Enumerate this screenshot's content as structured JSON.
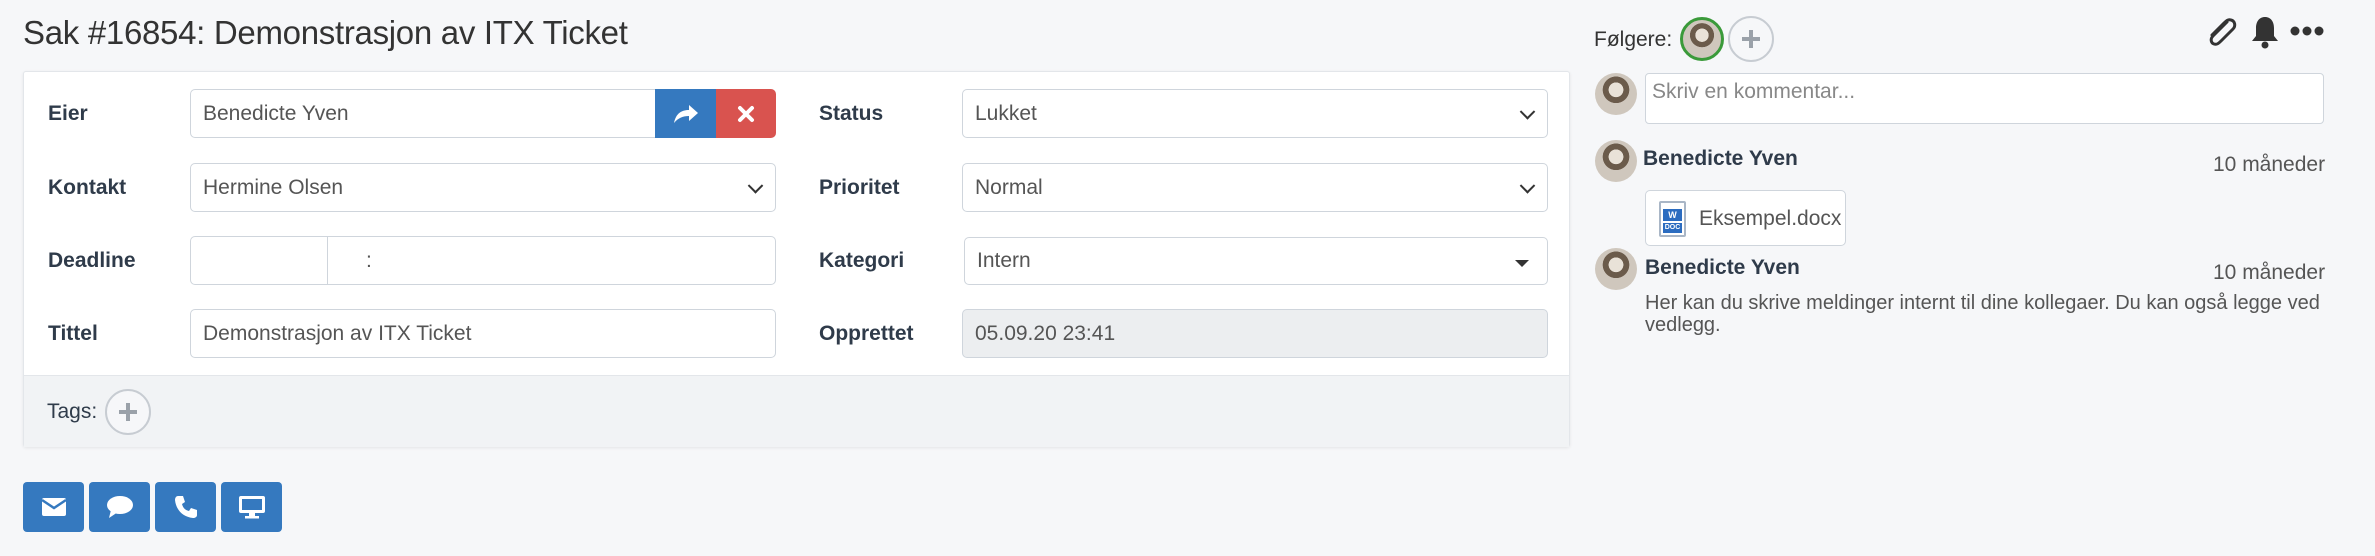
{
  "header": {
    "title": "Sak #16854: Demonstrasjon av ITX Ticket"
  },
  "form": {
    "owner": {
      "label": "Eier",
      "value": "Benedicte Yven"
    },
    "status": {
      "label": "Status",
      "value": "Lukket"
    },
    "contact": {
      "label": "Kontakt",
      "value": "Hermine Olsen"
    },
    "priority": {
      "label": "Prioritet",
      "value": "Normal"
    },
    "deadline": {
      "label": "Deadline",
      "date": "",
      "time_separator": ":"
    },
    "category": {
      "label": "Kategori",
      "value": "Intern"
    },
    "title_field": {
      "label": "Tittel",
      "value": "Demonstrasjon av ITX Ticket"
    },
    "created": {
      "label": "Opprettet",
      "value": "05.09.20 23:41"
    }
  },
  "tags": {
    "label": "Tags:"
  },
  "actions": [
    "envelope-icon",
    "speech-bubble-icon",
    "phone-icon",
    "monitor-icon"
  ],
  "followers": {
    "label": "Følgere:"
  },
  "toolbar_icons": [
    "paperclip-icon",
    "bell-icon",
    "ellipsis-icon"
  ],
  "comment": {
    "placeholder": "Skriv en kommentar..."
  },
  "activity": [
    {
      "author": "Benedicte Yven",
      "time": "10 måneder",
      "attachment": "Eksempel.docx"
    },
    {
      "author": "Benedicte Yven",
      "time": "10 måneder",
      "message": "Her kan du skrive meldinger internt til dine kollegaer. Du kan også legge ved vedlegg."
    }
  ],
  "colors": {
    "primary": "#3579bf",
    "danger": "#d9534f",
    "follower_ring": "#3a9a3a"
  }
}
